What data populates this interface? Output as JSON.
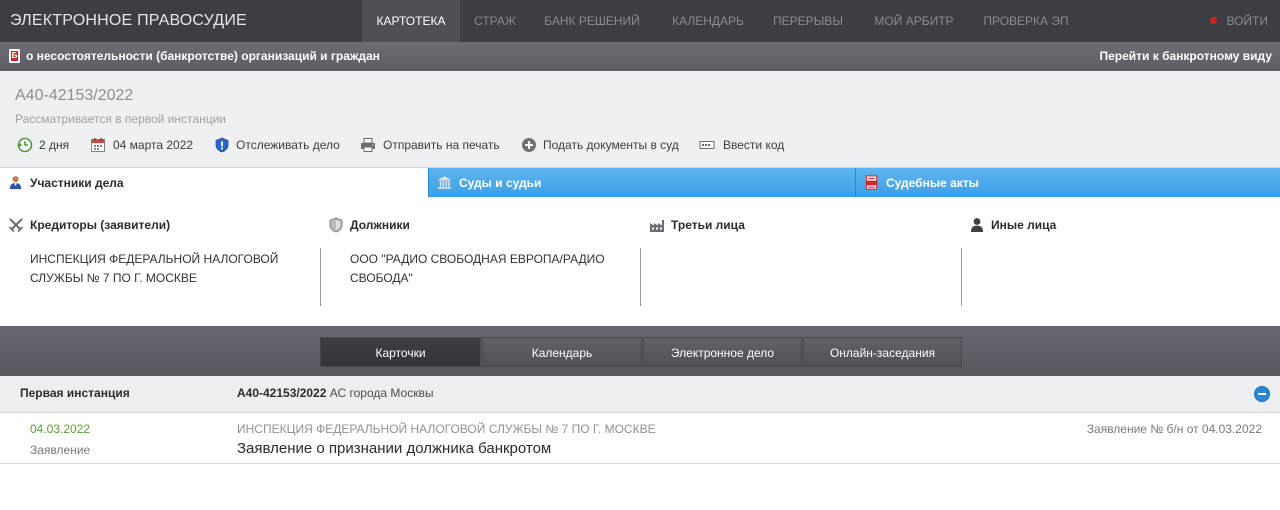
{
  "nav": {
    "brand": "ЭЛЕКТРОННОЕ ПРАВОСУДИЕ",
    "items": [
      "КАРТОТЕКА",
      "СТРАЖ",
      "БАНК РЕШЕНИЙ",
      "КАЛЕНДАРЬ",
      "ПЕРЕРЫВЫ",
      "МОЙ АРБИТР",
      "ПРОВЕРКА ЭП"
    ],
    "active_index": 0,
    "login": "ВОЙТИ"
  },
  "bankbar": {
    "icon_letter": "Б",
    "title": "о несостоятельности (банкротстве) организаций и граждан",
    "link": "Перейти к банкротному виду"
  },
  "case": {
    "number": "А40-42153/2022",
    "status": "Рассматривается в первой инстанции",
    "actions": [
      "2 дня",
      "04 марта 2022",
      "Отслеживать дело",
      "Отправить на печать",
      "Подать документы в суд",
      "Ввести код"
    ]
  },
  "tabs": [
    "Участники дела",
    "Суды и судьи",
    "Судебные акты"
  ],
  "participants": {
    "columns": [
      {
        "heading": "Кредиторы (заявители)",
        "text": "ИНСПЕКЦИЯ ФЕДЕРАЛЬНОЙ НАЛОГОВОЙ СЛУЖБЫ № 7 ПО Г. МОСКВЕ"
      },
      {
        "heading": "Должники",
        "text": "ООО \"РАДИО СВОБОДНАЯ ЕВРОПА/РАДИО СВОБОДА\""
      },
      {
        "heading": "Третьи лица",
        "text": ""
      },
      {
        "heading": "Иные лица",
        "text": ""
      }
    ]
  },
  "switcher": [
    "Карточки",
    "Календарь",
    "Электронное дело",
    "Онлайн-заседания"
  ],
  "instance": {
    "label": "Первая инстанция",
    "case_number": "А40-42153/2022",
    "court": "АС города Москвы"
  },
  "document": {
    "date": "04.03.2022",
    "type": "Заявление",
    "org": "ИНСПЕКЦИЯ ФЕДЕРАЛЬНОЙ НАЛОГОВОЙ СЛУЖБЫ № 7 ПО Г. МОСКВЕ",
    "title": "Заявление о признании должника банкротом",
    "ref": "Заявление № б/н от 04.03.2022"
  },
  "colors": {
    "accent_blue": "#3d9ee6",
    "date_green": "#5a9f2d",
    "brand_red": "#c8232c"
  }
}
